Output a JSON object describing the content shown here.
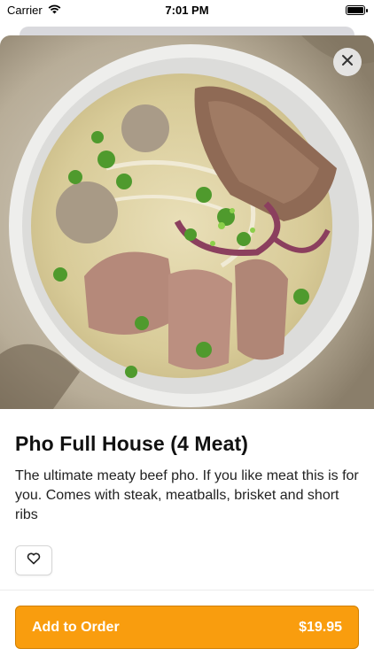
{
  "status_bar": {
    "carrier": "Carrier",
    "time": "7:01 PM",
    "icons": [
      "wifi-icon",
      "battery-icon"
    ]
  },
  "hero": {
    "image": "pho-bowl-photo",
    "close_icon": "close-icon"
  },
  "item": {
    "title": "Pho Full House (4 Meat)",
    "description": "The ultimate meaty beef pho. If you like meat this is for you. Comes with steak, meatballs, brisket and short ribs"
  },
  "favorite": {
    "icon": "heart-icon"
  },
  "order": {
    "label": "Add to Order",
    "price": "$19.95"
  },
  "colors": {
    "accent": "#f99d0e",
    "accent_border": "#d17f00"
  }
}
